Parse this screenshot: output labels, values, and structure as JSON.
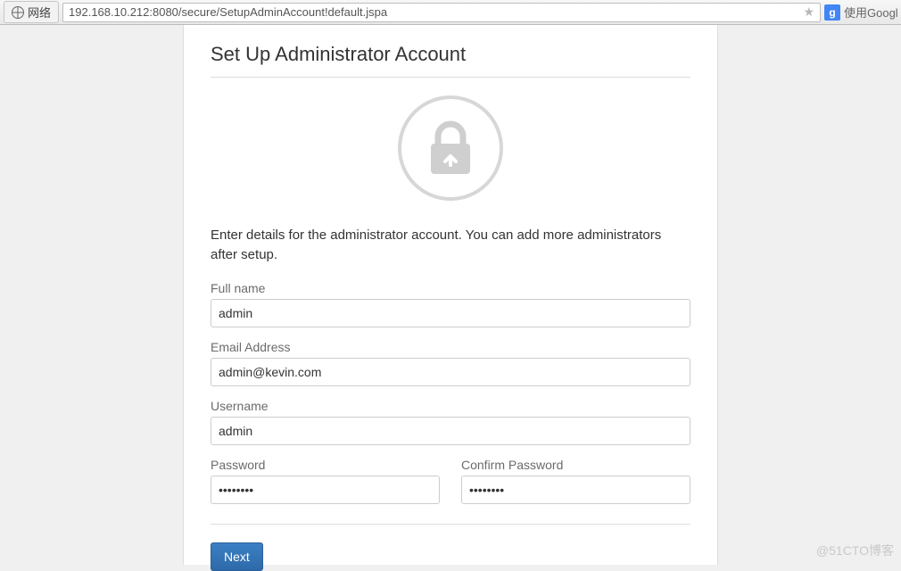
{
  "browser": {
    "net_label": "网络",
    "url": "192.168.10.212:8080/secure/SetupAdminAccount!default.jspa",
    "search_badge": "g",
    "search_hint": "使用Googl"
  },
  "page": {
    "title": "Set Up Administrator Account",
    "description": "Enter details for the administrator account. You can add more administrators after setup."
  },
  "form": {
    "fullname_label": "Full name",
    "fullname_value": "admin",
    "email_label": "Email Address",
    "email_value": "admin@kevin.com",
    "username_label": "Username",
    "username_value": "admin",
    "password_label": "Password",
    "password_value": "••••••••",
    "confirm_label": "Confirm Password",
    "confirm_value": "••••••••",
    "submit_label": "Next"
  },
  "watermark": "@51CTO博客"
}
